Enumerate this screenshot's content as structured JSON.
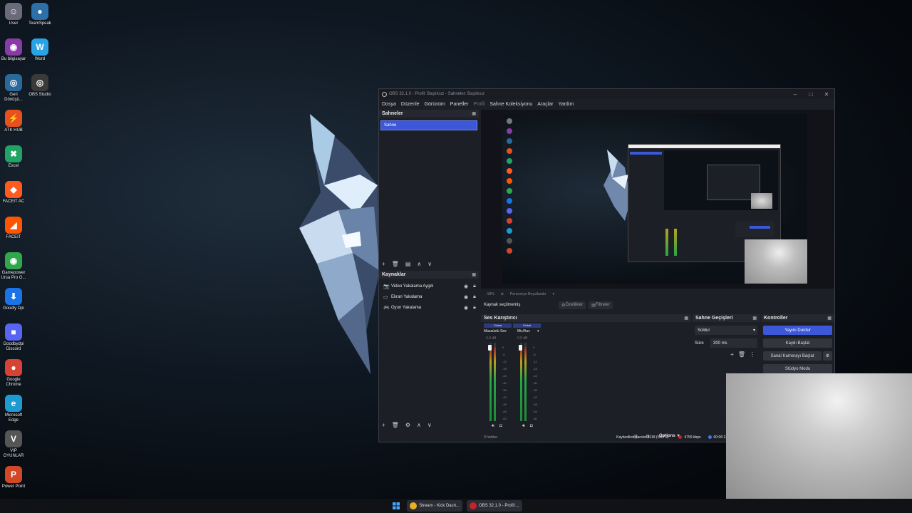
{
  "desktop": {
    "icons": [
      {
        "label": "User",
        "color": "#6a6a7a",
        "glyph": "☺"
      },
      {
        "label": "TeamSpeak",
        "color": "#2d6fa8",
        "glyph": "●"
      },
      {
        "label": "Bu bilgisayar",
        "color": "#8a3aa8",
        "glyph": "◉"
      },
      {
        "label": "Word",
        "color": "#2aa3e6",
        "glyph": "W"
      },
      {
        "label": "Geri\nDönüşü...",
        "color": "#2a6a9a",
        "glyph": "◎"
      },
      {
        "label": "OBS Studio",
        "color": "#3a3a3a",
        "glyph": "◎"
      },
      {
        "label": "ATK HUB",
        "color": "#e8501c",
        "glyph": "⚡"
      },
      {
        "label": "Excel",
        "color": "#21a366",
        "glyph": "✖"
      },
      {
        "label": "FACEIT AC",
        "color": "#ff5a1f",
        "glyph": "◆"
      },
      {
        "label": "FACEIT",
        "color": "#ff5500",
        "glyph": "◢"
      },
      {
        "label": "Gamepower\nUrsa Pro G...",
        "color": "#2ea84a",
        "glyph": "◉"
      },
      {
        "label": "Goodly Dpi",
        "color": "#1a73e8",
        "glyph": "⬇"
      },
      {
        "label": "Goodbydpi\nDiscord",
        "color": "#5865f2",
        "glyph": "■"
      },
      {
        "label": "Google\nChrome",
        "color": "#d64234",
        "glyph": "●"
      },
      {
        "label": "Microsoft\nEdge",
        "color": "#1d9bd1",
        "glyph": "e"
      },
      {
        "label": "VIP\nOYUNLAR",
        "color": "#555555",
        "glyph": "V"
      },
      {
        "label": "Power Point",
        "color": "#d24726",
        "glyph": "P"
      }
    ]
  },
  "obs": {
    "title": "OBS 32.1.0 - Profil: Başlıksız - Sahneler: Başlıksız",
    "window_controls": [
      "–",
      "□",
      "✕"
    ],
    "menu": [
      "Dosya",
      "Düzenle",
      "Görünüm",
      "Paneller",
      "Profil",
      "Sahne Koleksiyonu",
      "Araçlar",
      "Yardım"
    ],
    "scenes": {
      "title": "Sahneler",
      "items": [
        "Sahne"
      ],
      "toolbar": [
        "+",
        "🗑",
        "▤",
        "∧",
        "∨"
      ]
    },
    "sources": {
      "title": "Kaynaklar",
      "items": [
        {
          "name": "Video Yakalama Aygıtı",
          "icon": "📷"
        },
        {
          "name": "Ekran Yakalama",
          "icon": "▭"
        },
        {
          "name": "Oyun Yakalama",
          "icon": "🎮"
        }
      ],
      "toolbar": [
        "+",
        "🗑",
        "⚙",
        "∧",
        "∨"
      ]
    },
    "preview_bar": {
      "zoom": "-18%",
      "label": "Pencereye Boyutlandır"
    },
    "source_bar": {
      "no_source": "Kaynak seçilmemiş",
      "properties": "Özellikler",
      "filters": "Filtreler"
    },
    "mixer": {
      "title": "Ses Karıştırıcı",
      "channels": [
        {
          "tag": "Global",
          "name": "Masaüstü Ses",
          "db": "0.0 dB"
        },
        {
          "tag": "Global",
          "name": "Mic/Aux",
          "db": "0.0 dB"
        }
      ],
      "scale": [
        "0",
        "-6",
        "-12",
        "-18",
        "-24",
        "-30",
        "-36",
        "-42",
        "-48",
        "-54",
        "-60"
      ],
      "hidden": "0 hidden",
      "options": "Options"
    },
    "transitions": {
      "title": "Sahne Geçişleri",
      "type": "Soldur",
      "duration_label": "Süre",
      "duration": "300 ms"
    },
    "controls": {
      "title": "Kontroller",
      "buttons": [
        "Yayını Durdur",
        "Kaydı Başlat",
        "Sanal Kamerayı Başlat",
        "Stüdyo Modu"
      ]
    },
    "status": {
      "dropped": "Kaybedilen Kareler 3118 (%27.9)",
      "bitrate": "4759 kbps",
      "time": "00:06:13"
    }
  },
  "taskbar": {
    "items": [
      {
        "label": "Stream - Kick Dash...",
        "color": "#e8b21e"
      },
      {
        "label": "OBS 32.1.0 - Profil:...",
        "color": "#c8222a"
      }
    ]
  }
}
